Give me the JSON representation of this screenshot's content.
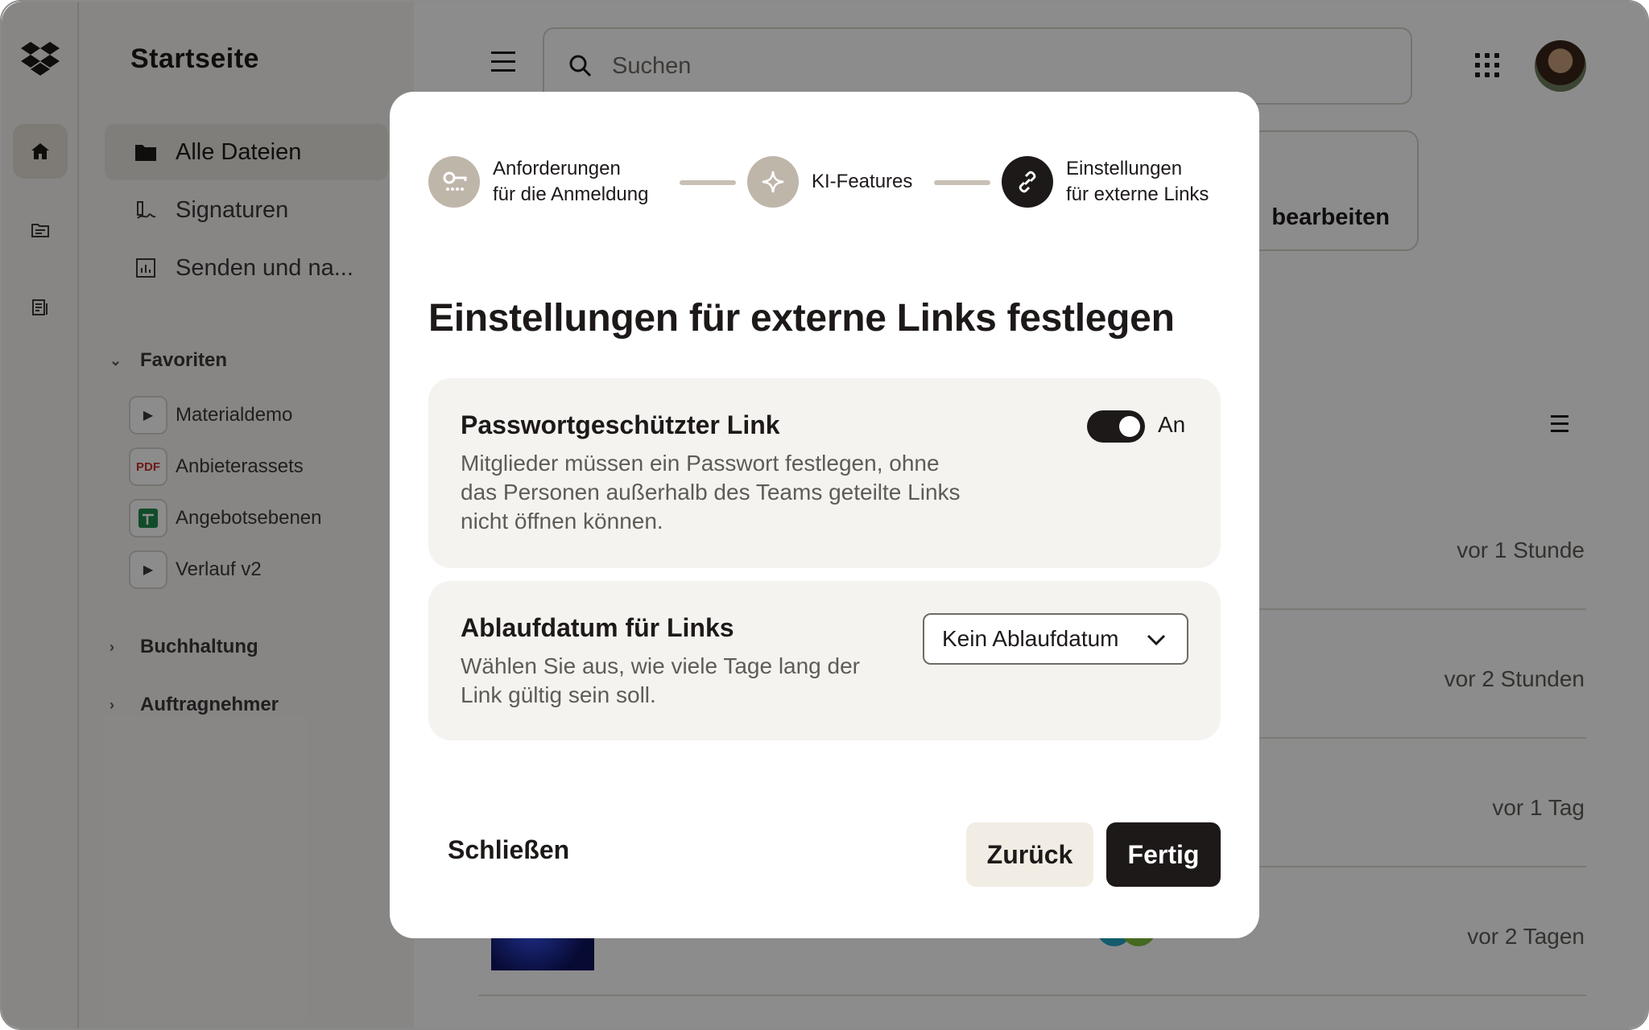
{
  "sidebar": {
    "title": "Startseite",
    "nav": [
      {
        "label": "Alle Dateien",
        "icon": "folder-icon",
        "active": true
      },
      {
        "label": "Signaturen",
        "icon": "signature-icon"
      },
      {
        "label": "Senden und na...",
        "icon": "chart-icon"
      }
    ],
    "favorites_label": "Favoriten",
    "favorites": [
      {
        "label": "Materialdemo",
        "icon": "play-icon"
      },
      {
        "label": "Anbieterassets",
        "icon": "pdf-icon",
        "badge": "PDF"
      },
      {
        "label": "Angebotsebenen",
        "icon": "spreadsheet-icon"
      },
      {
        "label": "Verlauf v2",
        "icon": "play-icon"
      }
    ],
    "sections": [
      "Buchhaltung",
      "Auftragnehmer"
    ]
  },
  "header": {
    "search_placeholder": "Suchen"
  },
  "main": {
    "edit_card_label": "bearbeiten",
    "rows": [
      {
        "when": "vor 1 Stunde"
      },
      {
        "when": "vor 2 Stunden"
      },
      {
        "when": "vor 1 Tag"
      },
      {
        "when": "vor 2 Tagen"
      }
    ]
  },
  "modal": {
    "steps": [
      {
        "label_line1": "Anforderungen",
        "label_line2": "für die Anmeldung",
        "icon": "key-icon"
      },
      {
        "label_line1": "KI-Features",
        "label_line2": "",
        "icon": "ai-sparkle-icon"
      },
      {
        "label_line1": "Einstellungen",
        "label_line2": "für externe Links",
        "icon": "link-icon",
        "active": true
      }
    ],
    "title": "Einstellungen für externe Links festlegen",
    "password_card": {
      "title": "Passwortgeschützter Link",
      "desc_line1": "Mitglieder müssen ein Passwort festlegen, ohne",
      "desc_line2": "das Personen außerhalb des Teams geteilte Links",
      "desc_line3": "nicht öffnen können.",
      "toggle_state": "An"
    },
    "expiry_card": {
      "title": "Ablaufdatum für Links",
      "desc_line1": "Wählen Sie aus, wie viele Tage lang der",
      "desc_line2": "Link gültig sein soll.",
      "select_value": "Kein Ablaufdatum"
    },
    "close_label": "Schließen",
    "back_label": "Zurück",
    "done_label": "Fertig"
  },
  "colors": {
    "accent_dark": "#1e1919",
    "card_bg": "#f5f3ef",
    "step_inactive": "#bfb6aa",
    "back_btn": "#f2ede4"
  }
}
